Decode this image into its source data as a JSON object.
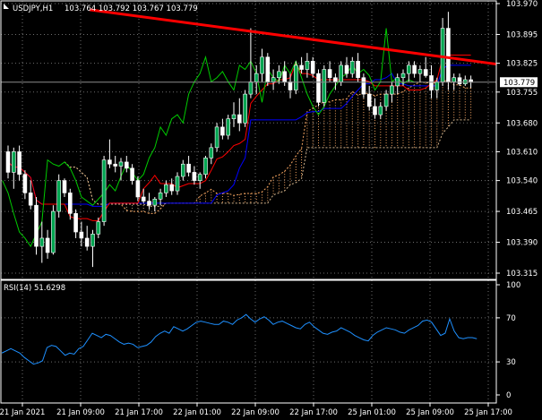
{
  "main_title": {
    "symbol": "USDJPY,H1",
    "ohlc": "103.764 103.792 103.767 103.779"
  },
  "price_scale": {
    "labels": [
      103.97,
      103.895,
      103.825,
      103.755,
      103.68,
      103.61,
      103.54,
      103.465,
      103.39,
      103.315
    ],
    "current_price": "103.779",
    "current_price_value": 103.779,
    "top_value": 103.97,
    "bottom_value": 103.315
  },
  "rsi_panel": {
    "label": "RSI(14) 51.6298",
    "levels": [
      100,
      70,
      30,
      0
    ],
    "values": [
      38,
      40,
      42,
      40,
      38,
      34,
      31,
      28,
      29,
      31,
      43,
      45,
      44,
      40,
      36,
      38,
      37,
      42,
      44,
      50,
      56,
      54,
      52,
      55,
      54,
      51,
      48,
      46,
      47,
      46,
      43,
      44,
      45,
      48,
      53,
      56,
      58,
      56,
      62,
      60,
      58,
      60,
      63,
      66,
      67,
      66,
      65,
      64,
      64,
      67,
      66,
      64,
      68,
      70,
      73,
      69,
      66,
      69,
      71,
      68,
      64,
      66,
      67,
      65,
      63,
      61,
      60,
      64,
      66,
      62,
      59,
      56,
      55,
      57,
      58,
      61,
      59,
      57,
      54,
      52,
      50,
      49,
      54,
      57,
      59,
      61,
      60,
      59,
      57,
      56,
      59,
      61,
      63,
      67,
      68,
      66,
      60,
      54,
      56,
      69,
      58,
      52,
      51,
      52,
      52,
      51
    ]
  },
  "time_axis": {
    "labels": [
      "21 Jan 2021",
      "21 Jan 09:00",
      "21 Jan 17:00",
      "22 Jan 01:00",
      "22 Jan 09:00",
      "22 Jan 17:00",
      "25 Jan 01:00",
      "25 Jan 09:00",
      "25 Jan 17:00"
    ]
  },
  "colors": {
    "background": "#000000",
    "grid": "#6e6e6e",
    "candle_up": "#00a651",
    "candle_down": "#ffffff",
    "tenkan": "#ff0000",
    "kijun": "#0000ff",
    "chikou": "#00cc00",
    "cloud_a": "#f4a460",
    "cloud_b": "#d2b48c",
    "trendline": "#ff0000",
    "rsi_line": "#1e90ff"
  },
  "chart_data": {
    "type": "candlestick",
    "symbol": "USDJPY",
    "timeframe": "H1",
    "ylim": [
      103.315,
      103.97
    ],
    "candles": [
      [
        103.61,
        103.625,
        103.545,
        103.56
      ],
      [
        103.56,
        103.62,
        103.52,
        103.61
      ],
      [
        103.61,
        103.625,
        103.54,
        103.555
      ],
      [
        103.555,
        103.565,
        103.495,
        103.51
      ],
      [
        103.51,
        103.54,
        103.47,
        103.48
      ],
      [
        103.48,
        103.5,
        103.36,
        103.38
      ],
      [
        103.38,
        103.44,
        103.34,
        103.4
      ],
      [
        103.4,
        103.42,
        103.35,
        103.365
      ],
      [
        103.365,
        103.48,
        103.36,
        103.465
      ],
      [
        103.465,
        103.555,
        103.45,
        103.54
      ],
      [
        103.54,
        103.545,
        103.5,
        103.51
      ],
      [
        103.51,
        103.52,
        103.445,
        103.46
      ],
      [
        103.46,
        103.47,
        103.4,
        103.415
      ],
      [
        103.415,
        103.44,
        103.38,
        103.4
      ],
      [
        103.4,
        103.43,
        103.37,
        103.38
      ],
      [
        103.38,
        103.42,
        103.33,
        103.41
      ],
      [
        103.41,
        103.45,
        103.4,
        103.44
      ],
      [
        103.44,
        103.6,
        103.43,
        103.59
      ],
      [
        103.59,
        103.64,
        103.57,
        103.58
      ],
      [
        103.58,
        103.6,
        103.56,
        103.575
      ],
      [
        103.575,
        103.595,
        103.54,
        103.585
      ],
      [
        103.585,
        103.6,
        103.56,
        103.57
      ],
      [
        103.57,
        103.58,
        103.53,
        103.54
      ],
      [
        103.54,
        103.55,
        103.49,
        103.5
      ],
      [
        103.5,
        103.52,
        103.485,
        103.49
      ],
      [
        103.49,
        103.51,
        103.47,
        103.48
      ],
      [
        103.48,
        103.5,
        103.465,
        103.495
      ],
      [
        103.495,
        103.52,
        103.48,
        103.51
      ],
      [
        103.51,
        103.54,
        103.5,
        103.53
      ],
      [
        103.53,
        103.545,
        103.505,
        103.515
      ],
      [
        103.515,
        103.56,
        103.505,
        103.55
      ],
      [
        103.55,
        103.59,
        103.54,
        103.58
      ],
      [
        103.58,
        103.6,
        103.55,
        103.56
      ],
      [
        103.56,
        103.575,
        103.53,
        103.54
      ],
      [
        103.54,
        103.56,
        103.52,
        103.555
      ],
      [
        103.555,
        103.6,
        103.545,
        103.595
      ],
      [
        103.595,
        103.63,
        103.58,
        103.62
      ],
      [
        103.62,
        103.68,
        103.61,
        103.67
      ],
      [
        103.67,
        103.69,
        103.64,
        103.65
      ],
      [
        103.65,
        103.7,
        103.64,
        103.69
      ],
      [
        103.69,
        103.73,
        103.67,
        103.7
      ],
      [
        103.7,
        103.74,
        103.66,
        103.68
      ],
      [
        103.68,
        103.76,
        103.67,
        103.75
      ],
      [
        103.75,
        103.91,
        103.74,
        103.78
      ],
      [
        103.78,
        103.82,
        103.75,
        103.8
      ],
      [
        103.8,
        103.86,
        103.78,
        103.84
      ],
      [
        103.84,
        103.85,
        103.77,
        103.78
      ],
      [
        103.78,
        103.81,
        103.76,
        103.79
      ],
      [
        103.79,
        103.82,
        103.775,
        103.805
      ],
      [
        103.805,
        103.83,
        103.77,
        103.78
      ],
      [
        103.78,
        103.8,
        103.74,
        103.76
      ],
      [
        103.76,
        103.83,
        103.75,
        103.82
      ],
      [
        103.82,
        103.84,
        103.8,
        103.81
      ],
      [
        103.81,
        103.85,
        103.79,
        103.83
      ],
      [
        103.83,
        103.84,
        103.79,
        103.8
      ],
      [
        103.8,
        103.81,
        103.72,
        103.73
      ],
      [
        103.73,
        103.82,
        103.72,
        103.81
      ],
      [
        103.81,
        103.83,
        103.78,
        103.79
      ],
      [
        103.79,
        103.8,
        103.76,
        103.78
      ],
      [
        103.78,
        103.83,
        103.77,
        103.82
      ],
      [
        103.82,
        103.84,
        103.79,
        103.8
      ],
      [
        103.8,
        103.84,
        103.79,
        103.83
      ],
      [
        103.83,
        103.85,
        103.78,
        103.79
      ],
      [
        103.79,
        103.8,
        103.74,
        103.75
      ],
      [
        103.75,
        103.77,
        103.71,
        103.72
      ],
      [
        103.72,
        103.74,
        103.69,
        103.7
      ],
      [
        103.7,
        103.73,
        103.69,
        103.72
      ],
      [
        103.72,
        103.76,
        103.71,
        103.75
      ],
      [
        103.75,
        103.78,
        103.73,
        103.77
      ],
      [
        103.77,
        103.8,
        103.75,
        103.79
      ],
      [
        103.79,
        103.81,
        103.77,
        103.8
      ],
      [
        103.8,
        103.83,
        103.78,
        103.82
      ],
      [
        103.82,
        103.83,
        103.79,
        103.8
      ],
      [
        103.8,
        103.82,
        103.78,
        103.81
      ],
      [
        103.81,
        103.84,
        103.79,
        103.795
      ],
      [
        103.795,
        103.82,
        103.74,
        103.76
      ],
      [
        103.76,
        103.79,
        103.74,
        103.78
      ],
      [
        103.78,
        103.935,
        103.77,
        103.91
      ],
      [
        103.91,
        103.95,
        103.76,
        103.78
      ],
      [
        103.78,
        103.8,
        103.76,
        103.79
      ],
      [
        103.79,
        103.8,
        103.77,
        103.775
      ],
      [
        103.775,
        103.795,
        103.77,
        103.785
      ],
      [
        103.785,
        103.795,
        103.765,
        103.779
      ]
    ],
    "trendline": {
      "start": [
        "21 Jan 09:00",
        103.955
      ],
      "end": [
        "25 Jan 18:00",
        103.823
      ]
    }
  }
}
